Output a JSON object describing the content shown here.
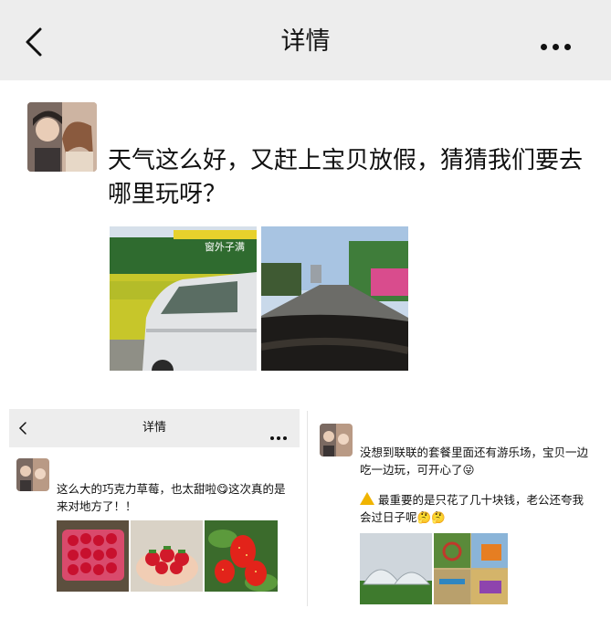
{
  "header": {
    "title": "详情",
    "back_icon": "chevron-left-icon",
    "more_icon": "more-dots-icon"
  },
  "post": {
    "text": "天气这么好，又赶上宝贝放假，猜猜我们要去哪里玩呀？",
    "images": [
      {
        "name": "van-roadside-photo",
        "watermark": "窗外子满"
      },
      {
        "name": "road-trip-windshield-photo"
      }
    ]
  },
  "screenshot_left": {
    "header_title": "详情",
    "text": "这么大的巧克力草莓，也太甜啦😋这次真的是来对地方了！！",
    "images": [
      "strawberry-basket-photo",
      "strawberries-in-hands-photo",
      "strawberries-on-plant-photo"
    ]
  },
  "screenshot_right": {
    "text_1": "没想到联联的套餐里面还有游乐场，宝贝一边吃一边玩，可开心了😜",
    "text_2": "最重要的是只花了几十块钱，老公还夸我会过日子呢🤔🤔",
    "images": [
      "greenhouse-field-photo",
      "playground-collage-photo"
    ]
  },
  "colors": {
    "header_bg": "#ededed",
    "text": "#111111",
    "emoji": "#f4c430"
  }
}
